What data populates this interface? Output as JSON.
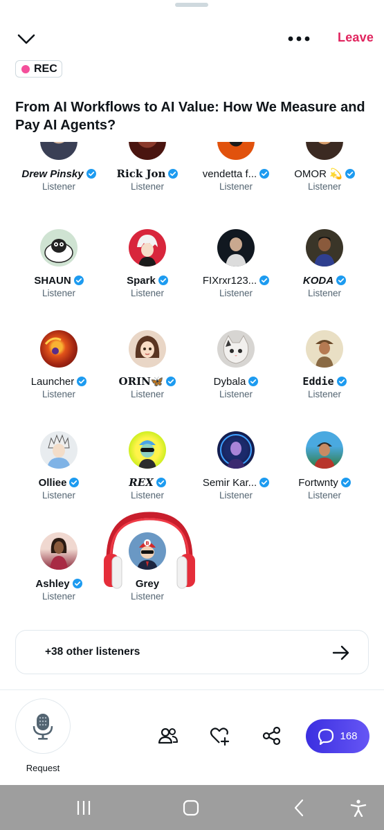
{
  "header": {
    "leave_label": "Leave",
    "rec_label": "REC",
    "title": "From AI Workflows to AI Value: How We Measure and Pay AI Agents?"
  },
  "listeners": [
    {
      "name": "Drew Pinsky",
      "role": "Listener",
      "verified": true,
      "avatar": "avatar-drew"
    },
    {
      "name": "Rick Jon",
      "role": "Listener",
      "verified": true,
      "avatar": "avatar-rick"
    },
    {
      "name": "vendetta f...",
      "role": "Listener",
      "verified": true,
      "avatar": "avatar-vendetta"
    },
    {
      "name": "OMOR 💫",
      "role": "Listener",
      "verified": true,
      "avatar": "avatar-omor"
    },
    {
      "name": "SHAUN",
      "role": "Listener",
      "verified": true,
      "avatar": "avatar-shaun"
    },
    {
      "name": "Spark",
      "role": "Listener",
      "verified": true,
      "avatar": "avatar-spark"
    },
    {
      "name": "FIXrxr123...",
      "role": "Listener",
      "verified": true,
      "avatar": "avatar-fixrxr"
    },
    {
      "name": "KODA",
      "role": "Listener",
      "verified": true,
      "avatar": "avatar-koda"
    },
    {
      "name": "Launcher",
      "role": "Listener",
      "verified": true,
      "avatar": "avatar-launcher"
    },
    {
      "name": "ORIN🦋",
      "role": "Listener",
      "verified": true,
      "avatar": "avatar-orin"
    },
    {
      "name": "Dybala",
      "role": "Listener",
      "verified": true,
      "avatar": "avatar-dybala"
    },
    {
      "name": "Eddie",
      "role": "Listener",
      "verified": true,
      "avatar": "avatar-eddie"
    },
    {
      "name": "Olliee",
      "role": "Listener",
      "verified": true,
      "avatar": "avatar-olliee"
    },
    {
      "name": "REX",
      "role": "Listener",
      "verified": true,
      "avatar": "avatar-rex"
    },
    {
      "name": "Semir Kar...",
      "role": "Listener",
      "verified": true,
      "avatar": "avatar-semir"
    },
    {
      "name": "Fortwnty",
      "role": "Listener",
      "verified": true,
      "avatar": "avatar-fortwnty"
    },
    {
      "name": "Ashley",
      "role": "Listener",
      "verified": true,
      "avatar": "avatar-ashley"
    },
    {
      "name": "Grey",
      "role": "Listener",
      "verified": false,
      "avatar": "avatar-grey"
    }
  ],
  "other_listeners": "+38 other listeners",
  "bottom": {
    "request_label": "Request",
    "chat_count": "168"
  },
  "colors": {
    "leave": "#e0245e",
    "rec_dot": "#f4509b",
    "verified": "#1d9bf0",
    "chat_button": "#4a3ef0"
  }
}
